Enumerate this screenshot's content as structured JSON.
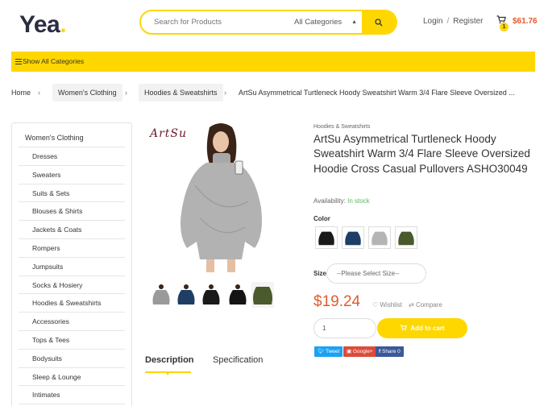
{
  "header": {
    "logo_text": "Yea",
    "logo_dot": ".",
    "search_placeholder": "Search for Products",
    "category_select": "All Categories",
    "login": "Login",
    "login_sep": "/",
    "register": "Register",
    "cart_count": "1",
    "cart_total": "$61.76"
  },
  "catbar": {
    "label": "Show All Categories"
  },
  "breadcrumb": {
    "items": [
      "Home",
      "Women's Clothing",
      "Hoodies & Sweatshirts",
      "ArtSu Asymmetrical Turtleneck Hoody Sweatshirt Warm 3/4 Flare Sleeve Oversized ..."
    ],
    "separator": "›"
  },
  "sidebar": {
    "heading": "Women's Clothing",
    "items": [
      "Dresses",
      "Sweaters",
      "Suits & Sets",
      "Blouses & Shirts",
      "Jackets & Coats",
      "Rompers",
      "Jumpsuits",
      "Socks & Hosiery",
      "Hoodies & Sweatshirts",
      "Accessories",
      "Tops & Tees",
      "Bodysuits",
      "Sleep & Lounge",
      "Intimates"
    ]
  },
  "gallery": {
    "brand_logo": "ArtSu",
    "thumbnail_colors": [
      "#9a9a9a",
      "#1f3e66",
      "#1a1a1a",
      "#141414",
      "#4a5a2c"
    ]
  },
  "tabs": {
    "description": "Description",
    "specification": "Specification"
  },
  "product": {
    "category": "Hoodies & Sweatshirts",
    "title": "ArtSu Asymmetrical Turtleneck Hoody Sweatshirt Warm 3/4 Flare Sleeve Oversized Hoodie Cross Casual Pullovers ASHO30049",
    "availability_label": "Availability:",
    "availability_value": "In stock",
    "color_label": "Color",
    "swatch_colors": [
      "#1a1a1a",
      "#1f3e66",
      "#b5b5b5",
      "#4a5a2c"
    ],
    "size_label": "Size",
    "size_placeholder": "--Please Select Size--",
    "price": "$19.24",
    "wishlist": "Wishlist",
    "compare": "Compare",
    "quantity": "1",
    "add_to_cart": "Add to cart",
    "share": {
      "tweet": "Tweet",
      "google": "Google+",
      "facebook": "Share 0"
    }
  },
  "colors": {
    "accent": "#fed700",
    "price": "#e05d2e",
    "in_stock": "#5cb85c",
    "twitter": "#1da1f2",
    "google": "#dd4b39",
    "facebook": "#3b5998"
  }
}
